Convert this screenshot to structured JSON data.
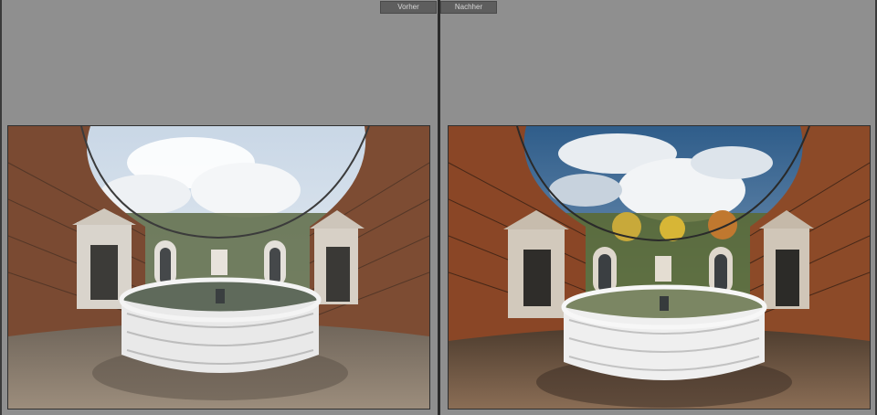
{
  "view_tabs": {
    "before_label": "Vorher",
    "after_label": "Nachher"
  },
  "images": {
    "before": {
      "sky_top": "#c9d7e6",
      "sky_bottom": "#eef2f6",
      "ground": "#8a7a68",
      "foliage": "#9a5a3a"
    },
    "after": {
      "sky_top": "#2f5d8a",
      "sky_bottom": "#c8d6e6",
      "ground": "#6e5744",
      "foliage": "#b0532b"
    }
  }
}
